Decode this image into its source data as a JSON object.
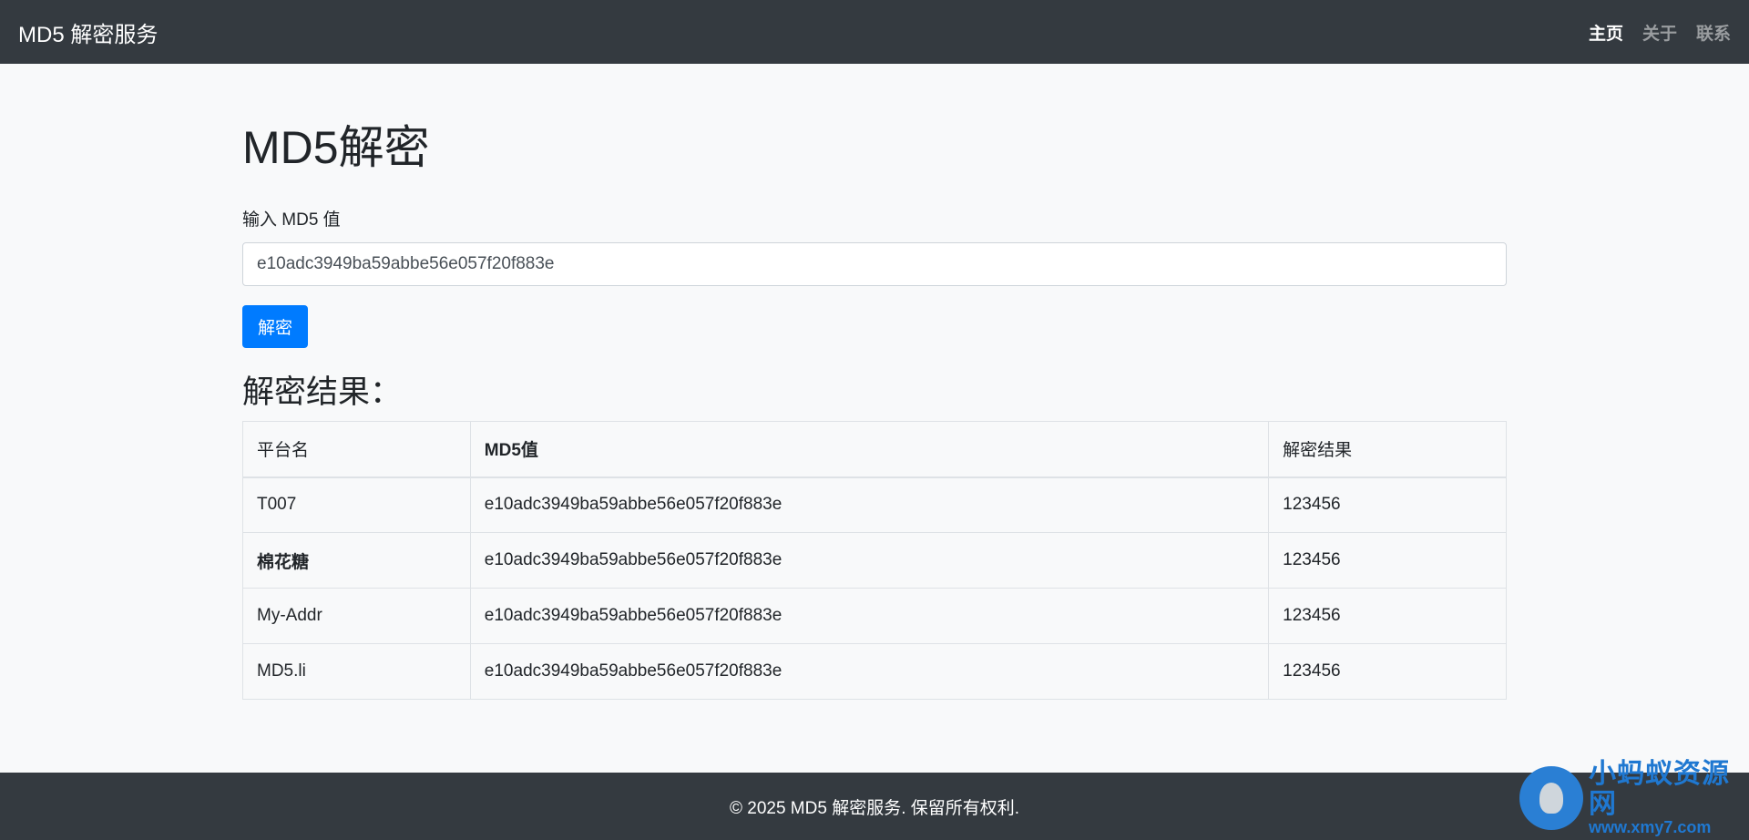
{
  "navbar": {
    "brand": "MD5 解密服务",
    "links": [
      {
        "label": "主页",
        "active": true
      },
      {
        "label": "关于",
        "active": false
      },
      {
        "label": "联系",
        "active": false
      }
    ]
  },
  "main": {
    "title": "MD5解密",
    "input_label": "输入 MD5 值",
    "input_value": "e10adc3949ba59abbe56e057f20f883e",
    "button_label": "解密",
    "result_heading": "解密结果："
  },
  "table": {
    "headers": [
      "平台名",
      "MD5值",
      "解密结果"
    ],
    "rows": [
      {
        "platform": "T007",
        "md5": "e10adc3949ba59abbe56e057f20f883e",
        "result": "123456"
      },
      {
        "platform": "棉花糖",
        "md5": "e10adc3949ba59abbe56e057f20f883e",
        "result": "123456"
      },
      {
        "platform": "My-Addr",
        "md5": "e10adc3949ba59abbe56e057f20f883e",
        "result": "123456"
      },
      {
        "platform": "MD5.li",
        "md5": "e10adc3949ba59abbe56e057f20f883e",
        "result": "123456"
      }
    ]
  },
  "footer": {
    "text": "© 2025 MD5 解密服务. 保留所有权利."
  },
  "watermark": {
    "name": "小蚂蚁资源网",
    "url": "www.xmy7.com",
    "icon": "ant-logo-icon"
  },
  "colors": {
    "navbar_bg": "#343a40",
    "page_bg": "#f8f9fa",
    "primary": "#007bff",
    "nav_muted": "#9a9da0"
  }
}
